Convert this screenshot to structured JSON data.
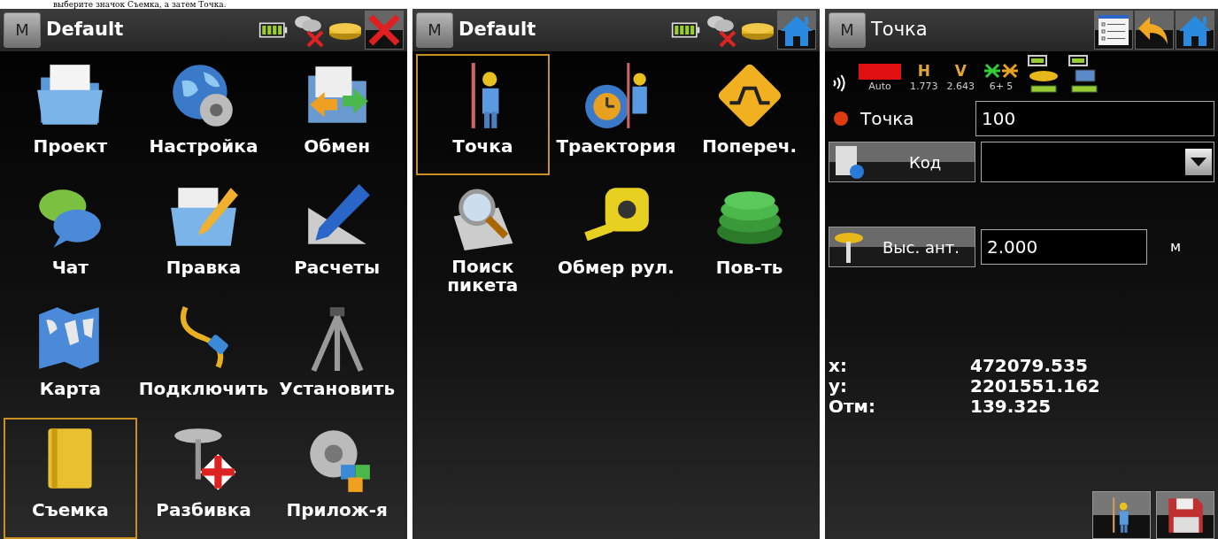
{
  "caption": "выберите значок Съемка, а затем Точка.",
  "screens": [
    {
      "kind": "menu",
      "menu_button": "M",
      "title": "Default",
      "status": [
        {
          "kind": "battery"
        },
        {
          "kind": "cloud-offline"
        },
        {
          "kind": "receiver"
        }
      ],
      "actions": [
        {
          "kind": "close"
        }
      ],
      "items": [
        {
          "label": "Проект",
          "selected": false
        },
        {
          "label": "Настройка",
          "selected": false
        },
        {
          "label": "Обмен",
          "selected": false
        },
        {
          "label": "Чат",
          "selected": false
        },
        {
          "label": "Правка",
          "selected": false
        },
        {
          "label": "Расчеты",
          "selected": false
        },
        {
          "label": "Карта",
          "selected": false
        },
        {
          "label": "Подключить",
          "selected": false
        },
        {
          "label": "Установить",
          "selected": false
        },
        {
          "label": "Съемка",
          "selected": true
        },
        {
          "label": "Разбивка",
          "selected": false
        },
        {
          "label": "Прилож-я",
          "selected": false
        }
      ]
    },
    {
      "kind": "menu",
      "menu_button": "M",
      "title": "Default",
      "status": [
        {
          "kind": "battery"
        },
        {
          "kind": "cloud-offline"
        },
        {
          "kind": "receiver"
        }
      ],
      "actions": [
        {
          "kind": "home"
        }
      ],
      "items": [
        {
          "label": "Точка",
          "selected": true
        },
        {
          "label": "Траектория",
          "selected": false
        },
        {
          "label": "Попереч.",
          "selected": false
        },
        {
          "label": "Поиск пикета",
          "selected": false
        },
        {
          "label": "Обмер рул.",
          "selected": false
        },
        {
          "label": "Пов-ть",
          "selected": false
        }
      ]
    },
    {
      "kind": "form",
      "menu_button": "M",
      "title": "Точка",
      "actions": [
        {
          "kind": "list"
        },
        {
          "kind": "back"
        },
        {
          "kind": "home"
        }
      ],
      "status": [
        {
          "kind": "radio"
        },
        {
          "kind": "solution",
          "label": "Auto"
        },
        {
          "kind": "letter",
          "glyph": "H",
          "label": "1.773"
        },
        {
          "kind": "letter",
          "glyph": "V",
          "label": "2.643"
        },
        {
          "kind": "satellites",
          "label": "6+ 5"
        },
        {
          "kind": "receiver-battery"
        },
        {
          "kind": "controller-battery"
        }
      ],
      "point": {
        "label": "Точка",
        "value": "100"
      },
      "code": {
        "button": "Код"
      },
      "antenna": {
        "button": "Выс. ант.",
        "value": "2.000",
        "unit": "м"
      },
      "coords": [
        {
          "label": "x:",
          "value": "472079.535"
        },
        {
          "label": "y:",
          "value": "2201551.162"
        },
        {
          "label": "Отм:",
          "value": "139.325"
        }
      ],
      "bottom": [
        {
          "kind": "surveyor"
        },
        {
          "kind": "save"
        }
      ]
    }
  ]
}
